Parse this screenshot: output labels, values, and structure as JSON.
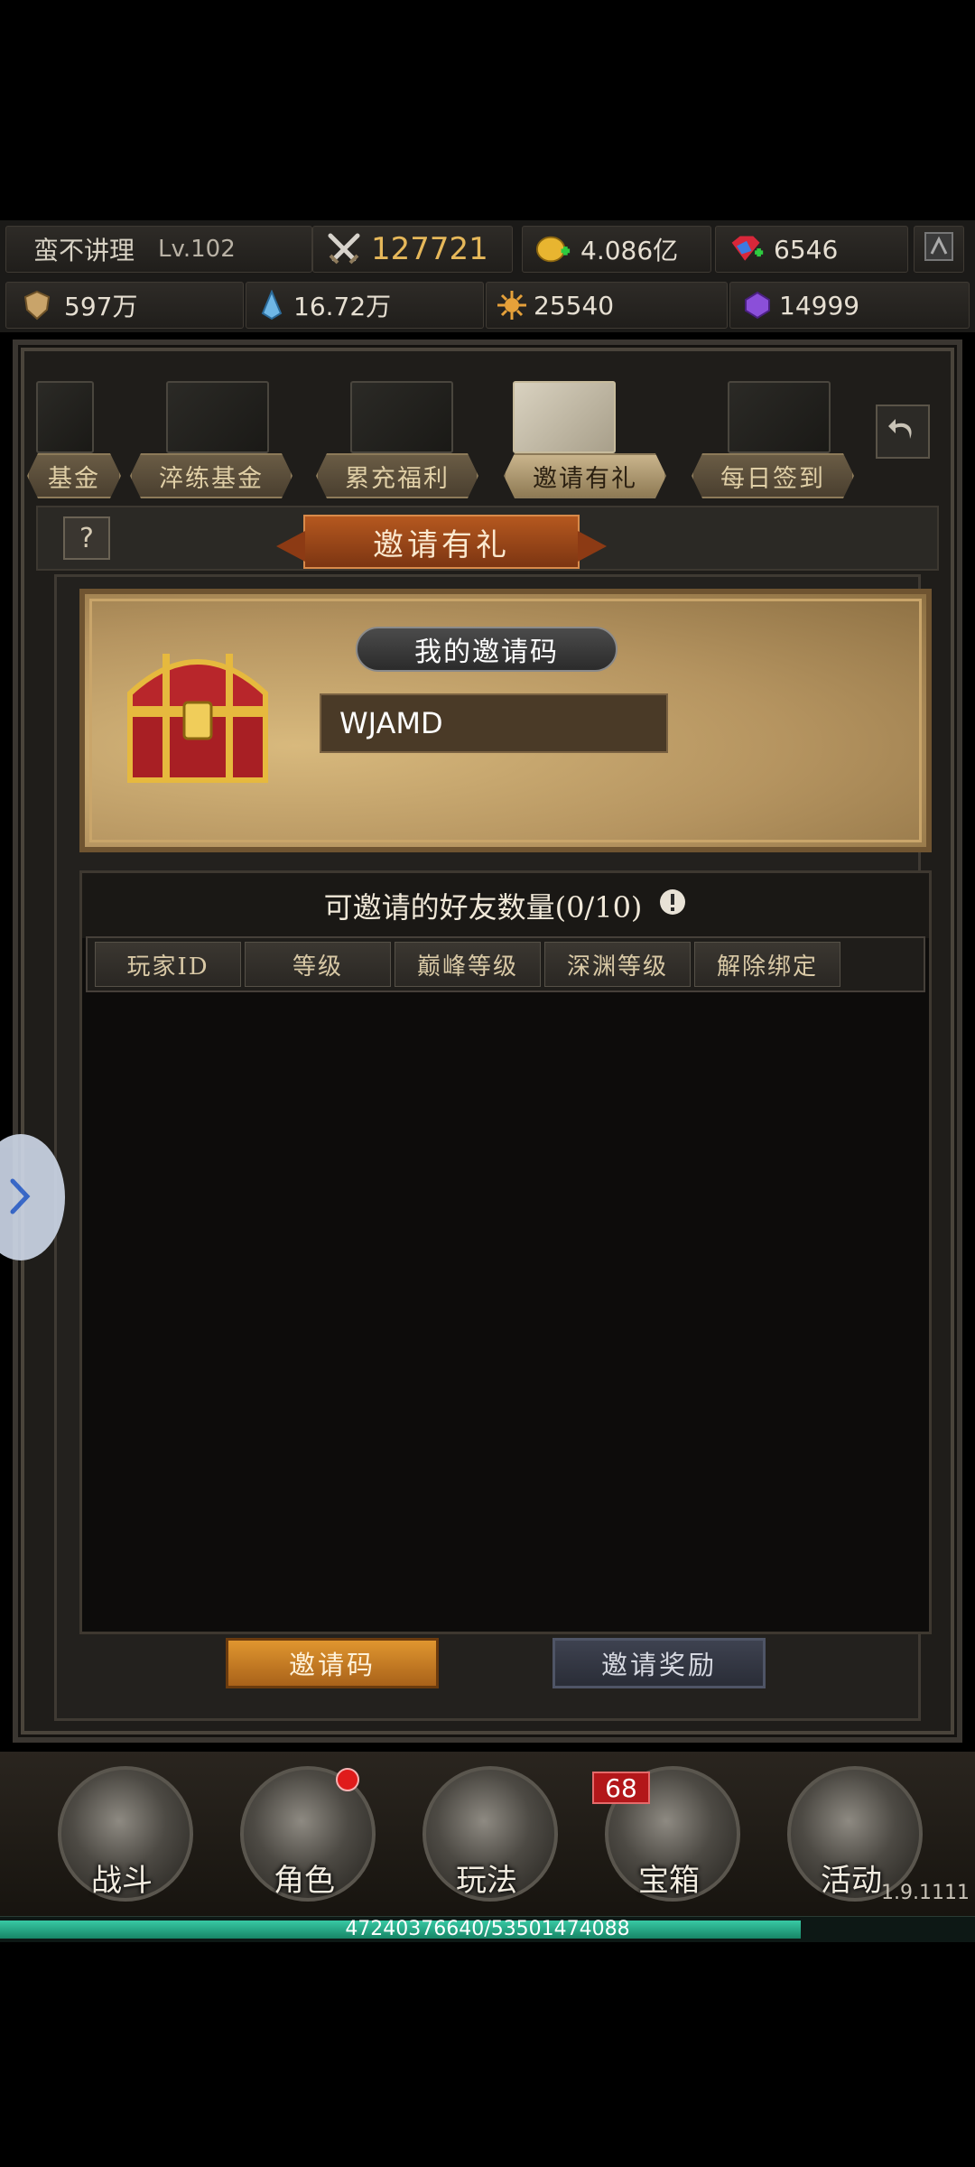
{
  "player": {
    "name": "蛮不讲理",
    "level": "Lv.102",
    "power": "127721"
  },
  "currencies": {
    "gold": "4.086亿",
    "gems": "6546",
    "resource1": "597万",
    "resource2": "16.72万",
    "resource3": "25540",
    "resource4": "14999"
  },
  "tabs": [
    {
      "label": "基金",
      "active": false
    },
    {
      "label": "淬练基金",
      "active": false
    },
    {
      "label": "累充福利",
      "active": false
    },
    {
      "label": "邀请有礼",
      "active": true
    },
    {
      "label": "每日签到",
      "active": false
    }
  ],
  "panel": {
    "title": "邀请有礼",
    "help": "?",
    "invite_code_label": "我的邀请码",
    "invite_code": "WJAMD",
    "friends_title": "可邀请的好友数量(0/10)",
    "columns": [
      "玩家ID",
      "等级",
      "巅峰等级",
      "深渊等级",
      "解除绑定"
    ],
    "buttons": {
      "invite_code": "邀请码",
      "invite_reward": "邀请奖励"
    }
  },
  "nav": [
    {
      "label": "战斗",
      "badge": ""
    },
    {
      "label": "角色",
      "badge": "dot"
    },
    {
      "label": "玩法",
      "badge": ""
    },
    {
      "label": "宝箱",
      "badge": "68"
    },
    {
      "label": "活动",
      "badge": ""
    }
  ],
  "version": "1.9.1111",
  "exp": {
    "text": "47240376640/53501474088",
    "fraction": 0.883
  },
  "colors": {
    "accent_gold": "#e6b85a",
    "exp_green": "#2fb894",
    "badge_red": "#b3171a"
  },
  "icons": [
    "sword-icon",
    "gold-coin-icon",
    "gem-icon",
    "settings-icon",
    "shield-icon",
    "crystal-icon",
    "sun-icon",
    "purple-gem-icon",
    "back-icon",
    "help-icon",
    "chest-icon",
    "info-icon",
    "chevron-right-icon"
  ]
}
